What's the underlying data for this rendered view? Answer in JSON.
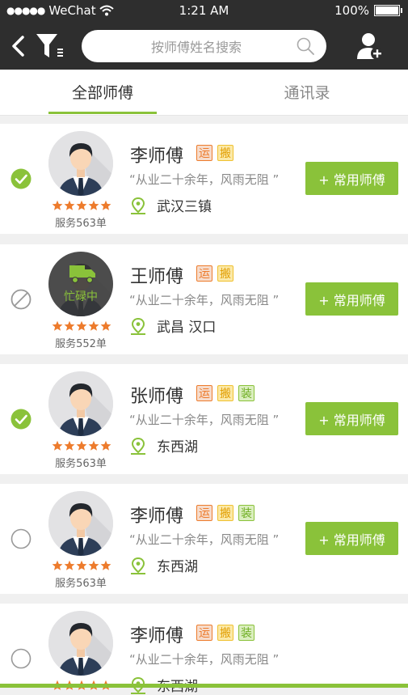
{
  "status_bar": {
    "carrier": "WeChat",
    "time": "1:21 AM",
    "battery": "100%"
  },
  "search": {
    "placeholder": "按师傅姓名搜索"
  },
  "tabs": [
    {
      "label": "全部师傅"
    },
    {
      "label": "通讯录"
    }
  ],
  "colors": {
    "accent": "#8ac23a",
    "header": "#2e2e2e",
    "star": "#ed7b2c"
  },
  "masters": [
    {
      "name": "李师傅",
      "tags": [
        "运",
        "搬"
      ],
      "motto": "“从业二十余年，风雨无阻 ”",
      "location": "武汉三镇",
      "orders": "服务563单",
      "rating": 5,
      "state": "selected",
      "busy": false,
      "button": "+ 常用师傅"
    },
    {
      "name": "王师傅",
      "tags": [
        "运",
        "搬"
      ],
      "motto": "“从业二十余年，风雨无阻 ”",
      "location": "武昌  汉口",
      "orders": "服务552单",
      "rating": 5,
      "state": "disabled",
      "busy": true,
      "busy_label": "忙碌中",
      "button": "+ 常用师傅"
    },
    {
      "name": "张师傅",
      "tags": [
        "运",
        "搬",
        "装"
      ],
      "motto": "“从业二十余年，风雨无阻 ”",
      "location": "东西湖",
      "orders": "服务563单",
      "rating": 5,
      "state": "selected",
      "busy": false,
      "button": "+ 常用师傅"
    },
    {
      "name": "李师傅",
      "tags": [
        "运",
        "搬",
        "装"
      ],
      "motto": "“从业二十余年，风雨无阻 ”",
      "location": "东西湖",
      "orders": "服务563单",
      "rating": 5,
      "state": "unselected",
      "busy": false,
      "button": "+ 常用师傅"
    },
    {
      "name": "李师傅",
      "tags": [
        "运",
        "搬",
        "装"
      ],
      "motto": "“从业二十余年，风雨无阻 ”",
      "location": "东西湖",
      "orders": "",
      "rating": 5,
      "state": "unselected",
      "busy": false,
      "button": ""
    }
  ]
}
